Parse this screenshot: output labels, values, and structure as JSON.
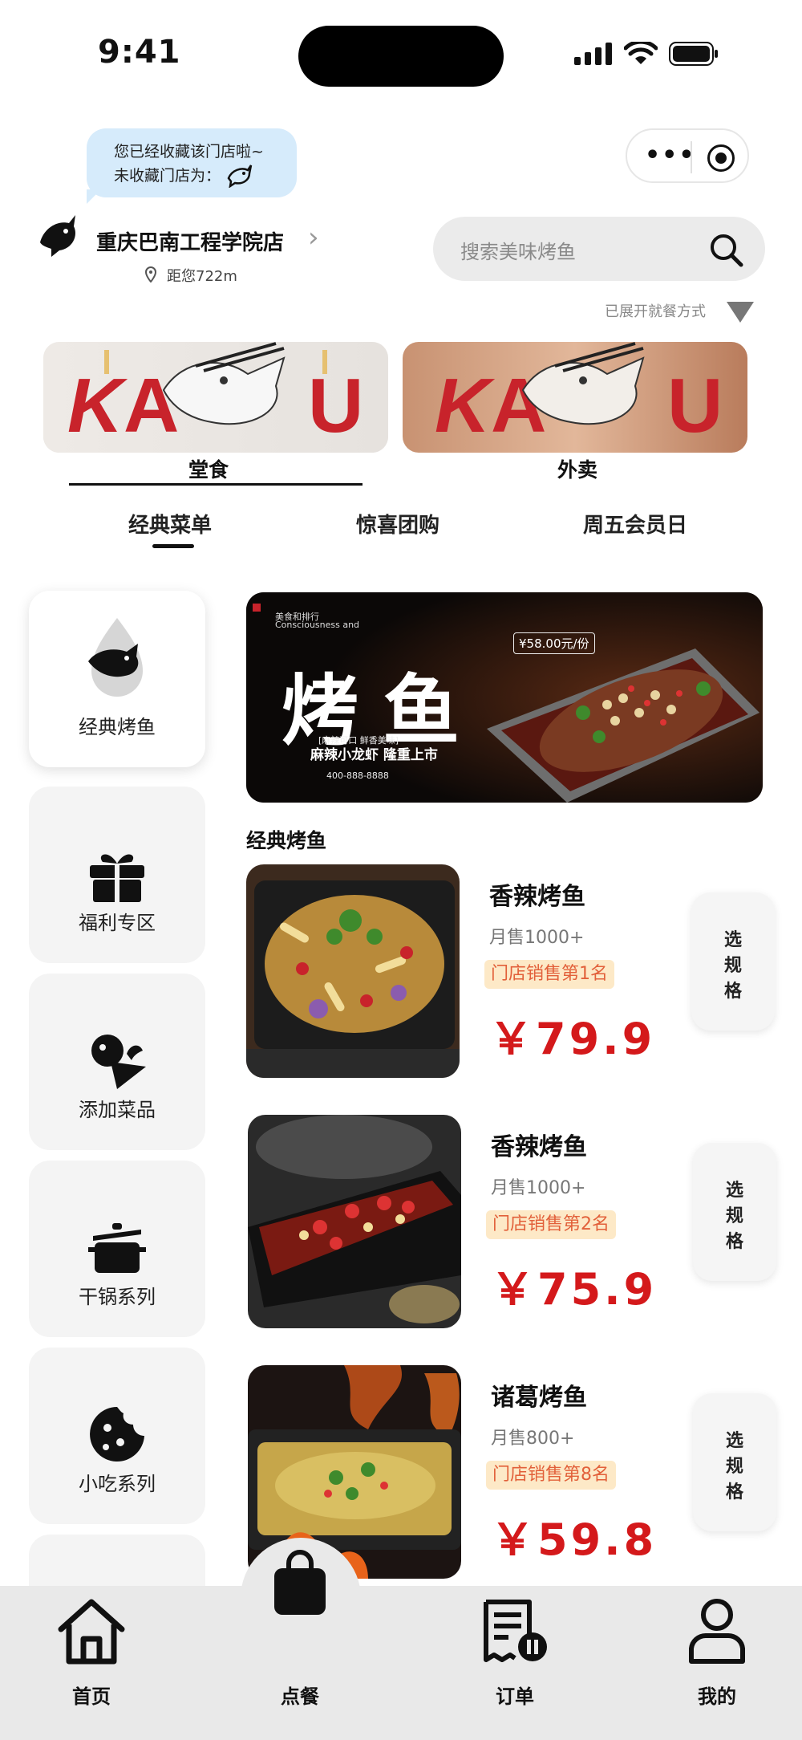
{
  "status_bar": {
    "time": "9:41"
  },
  "toast": {
    "line1": "您已经收藏该门店啦~",
    "line2": "未收藏门店为："
  },
  "store": {
    "name": "重庆巴南工程学院店",
    "distance": "距您722m"
  },
  "search": {
    "placeholder": "搜索美味烤鱼"
  },
  "dine_mode_hint": "已展开就餐方式",
  "service_modes": [
    {
      "label": "堂食"
    },
    {
      "label": "外卖"
    }
  ],
  "menu_tabs": [
    {
      "label": "经典菜单"
    },
    {
      "label": "惊喜团购"
    },
    {
      "label": "周五会员日"
    }
  ],
  "categories": [
    {
      "label": "经典烤鱼",
      "icon": "fish-icon"
    },
    {
      "label": "福利专区",
      "icon": "gift-icon"
    },
    {
      "label": "添加菜品",
      "icon": "vegetable-icon"
    },
    {
      "label": "干锅系列",
      "icon": "pot-icon"
    },
    {
      "label": "小吃系列",
      "icon": "cookie-icon"
    }
  ],
  "hero": {
    "brand_small": "美食和排行",
    "brand_en": "Consciousness and",
    "title": "烤鱼",
    "subtitle": "麻辣小龙虾 隆重上市",
    "tagline": "[麻辣可口 鲜香美味]",
    "phone": "400-888-8888",
    "price_badge": "¥58.00元/份"
  },
  "section_title": "经典烤鱼",
  "dishes": [
    {
      "name": "香辣烤鱼",
      "sales": "月售1000+",
      "rank": "门店销售第1名",
      "price": "￥79.9",
      "button": "选规格"
    },
    {
      "name": "香辣烤鱼",
      "sales": "月售1000+",
      "rank": "门店销售第2名",
      "price": "￥75.9",
      "button": "选规格"
    },
    {
      "name": "诸葛烤鱼",
      "sales": "月售800+",
      "rank": "门店销售第8名",
      "price": "￥59.8",
      "button": "选规格"
    }
  ],
  "bottom_nav": [
    {
      "label": "首页"
    },
    {
      "label": "点餐"
    },
    {
      "label": "订单"
    },
    {
      "label": "我的"
    }
  ],
  "colors": {
    "price": "#d4191b",
    "rank_bg": "#fde9c7",
    "rank_text": "#e2603a",
    "toast_bg": "#d6ebfb",
    "tabbar_bg": "#e9e9e9"
  }
}
